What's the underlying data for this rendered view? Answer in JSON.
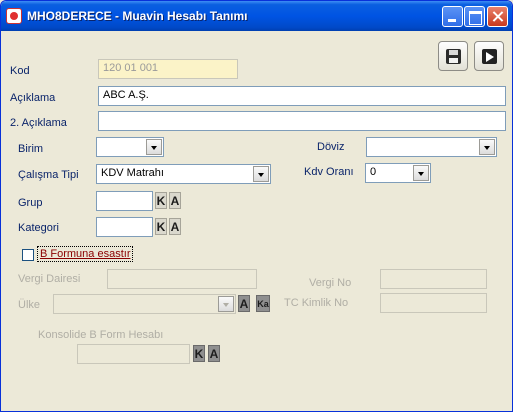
{
  "window": {
    "title": "MHO8DERECE - Muavin Hesabı Tanımı"
  },
  "form": {
    "kod": {
      "label": "Kod",
      "value": "120 01 001"
    },
    "aciklama": {
      "label": "Açıklama",
      "value": "ABC A.Ş."
    },
    "aciklama2": {
      "label": "2. Açıklama",
      "value": ""
    },
    "birim": {
      "label": "Birim",
      "value": ""
    },
    "doviz": {
      "label": "Döviz",
      "value": ""
    },
    "calisma_tipi": {
      "label": "Çalışma Tipi",
      "value": "KDV Matrahı"
    },
    "kdv_orani": {
      "label": "Kdv Oranı",
      "value": "0"
    },
    "grup": {
      "label": "Grup",
      "value": ""
    },
    "kategori": {
      "label": "Kategori",
      "value": ""
    },
    "b_formu": {
      "label": "B Formuna esastır",
      "checked": false
    },
    "vergi_dairesi": {
      "label": "Vergi Dairesi",
      "value": ""
    },
    "vergi_no": {
      "label": "Vergi No",
      "value": ""
    },
    "ulke": {
      "label": "Ülke",
      "value": ""
    },
    "tc_kimlik": {
      "label": "TC Kimlik No",
      "value": ""
    },
    "konsolide": {
      "label": "Konsolide B Form Hesabı",
      "value": ""
    }
  },
  "mini_buttons": {
    "k": "K",
    "a": "A",
    "ka": "Ka"
  },
  "icons": {
    "save": "save-icon",
    "exit": "exit-icon",
    "app": "app-icon"
  },
  "colors": {
    "titlebar": "#0054e3",
    "window_bg": "#ece9d8",
    "label_blue": "#0a246a",
    "checkbox_label": "#8b0000",
    "readonly_bg": "#fbf3c8"
  }
}
